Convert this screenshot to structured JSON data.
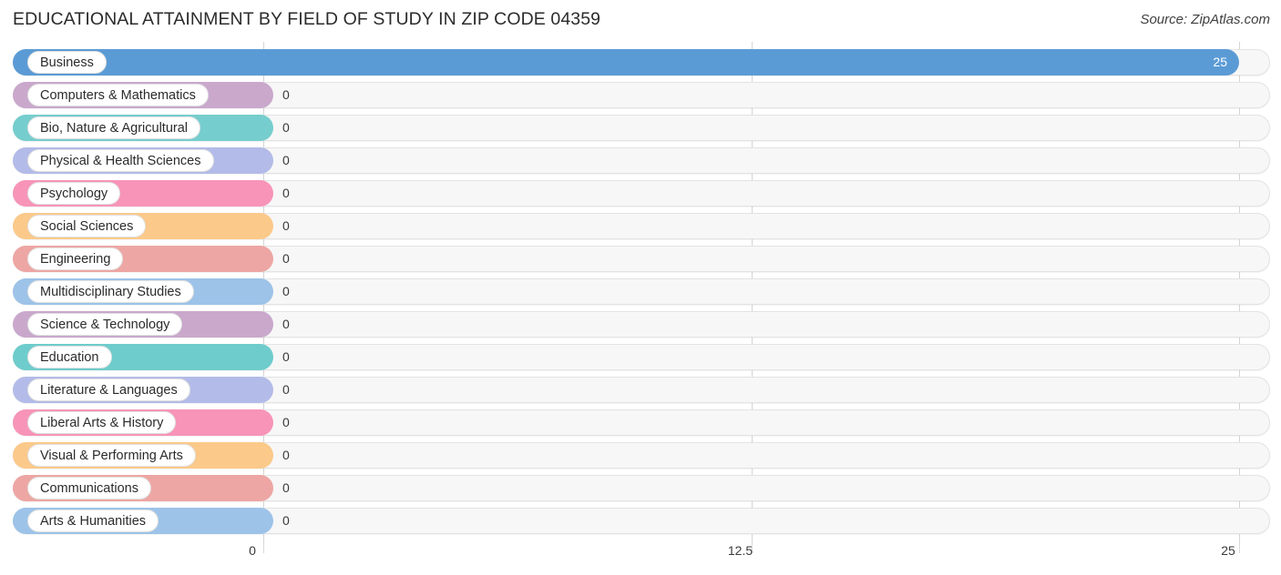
{
  "header": {
    "title": "EDUCATIONAL ATTAINMENT BY FIELD OF STUDY IN ZIP CODE 04359",
    "source": "Source: ZipAtlas.com"
  },
  "chart_data": {
    "type": "bar",
    "orientation": "horizontal",
    "title": "EDUCATIONAL ATTAINMENT BY FIELD OF STUDY IN ZIP CODE 04359",
    "xlabel": "",
    "ylabel": "",
    "xlim": [
      0,
      25
    ],
    "ticks": [
      "0",
      "12.5",
      "25"
    ],
    "tick_values": [
      0,
      12.5,
      25
    ],
    "grid": true,
    "legend": "none",
    "categories": [
      "Business",
      "Computers & Mathematics",
      "Bio, Nature & Agricultural",
      "Physical & Health Sciences",
      "Psychology",
      "Social Sciences",
      "Engineering",
      "Multidisciplinary Studies",
      "Science & Technology",
      "Education",
      "Literature & Languages",
      "Liberal Arts & History",
      "Visual & Performing Arts",
      "Communications",
      "Arts & Humanities"
    ],
    "values": [
      25,
      0,
      0,
      0,
      0,
      0,
      0,
      0,
      0,
      0,
      0,
      0,
      0,
      0,
      0
    ],
    "value_labels": [
      "25",
      "0",
      "0",
      "0",
      "0",
      "0",
      "0",
      "0",
      "0",
      "0",
      "0",
      "0",
      "0",
      "0",
      "0"
    ],
    "colors": [
      "#5b9bd5",
      "#c9a8cc",
      "#76cdcd",
      "#b3bbe8",
      "#f794b8",
      "#fbc98a",
      "#eda6a3",
      "#9dc3e8",
      "#c9a8cc",
      "#6fcccc",
      "#b3bbe8",
      "#f794b8",
      "#fbc98a",
      "#eda6a3",
      "#9dc3e8"
    ]
  }
}
